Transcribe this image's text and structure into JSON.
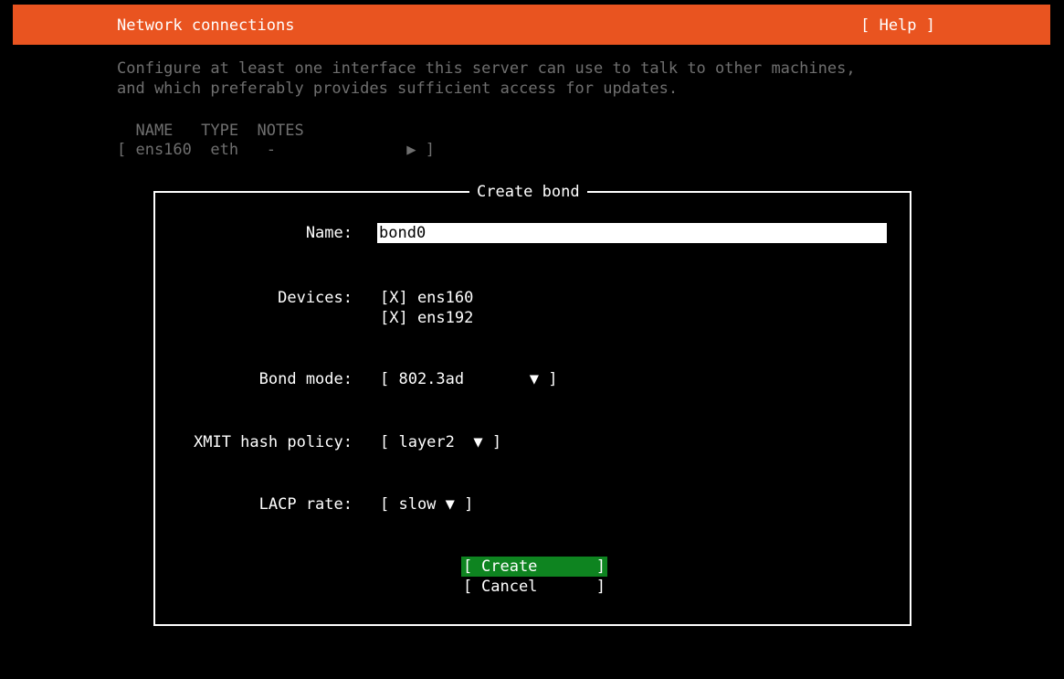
{
  "header": {
    "title": "Network connections",
    "help_label": "[ Help ]"
  },
  "description": {
    "line1": "Configure at least one interface this server can use to talk to other machines,",
    "line2": "and which preferably provides sufficient access for updates."
  },
  "interfaces": {
    "columns": [
      "NAME",
      "TYPE",
      "NOTES"
    ],
    "header_line": "  NAME   TYPE  NOTES",
    "row_line": "[ ens160  eth   -              ▶ ]"
  },
  "dialog": {
    "title": "Create bond",
    "name": {
      "label": "Name:",
      "value": "bond0"
    },
    "devices": {
      "label": "Devices:",
      "items": [
        "[X] ens160",
        "[X] ens192"
      ]
    },
    "bond_mode": {
      "label": "Bond mode:",
      "display": "[ 802.3ad       ▼ ]"
    },
    "xmit_hash_policy": {
      "label": "XMIT hash policy:",
      "display": "[ layer2  ▼ ]"
    },
    "lacp_rate": {
      "label": "LACP rate:",
      "display": "[ slow ▼ ]"
    },
    "buttons": {
      "create": "Create",
      "cancel": "Cancel",
      "left_bracket": "[",
      "right_bracket": "]"
    }
  },
  "colors": {
    "header_bg": "#e95420",
    "primary_button_bg": "#0e8420",
    "dim_text": "#6f6f6f",
    "background": "#000000",
    "foreground": "#ffffff"
  }
}
